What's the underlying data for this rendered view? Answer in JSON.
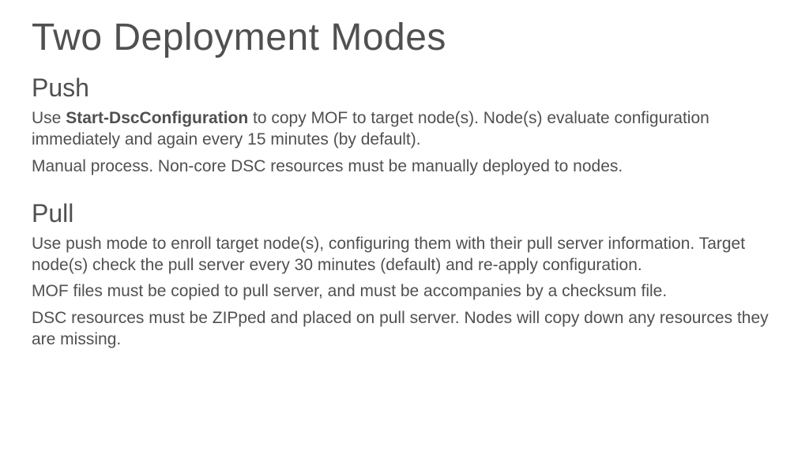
{
  "title": "Two Deployment Modes",
  "sections": [
    {
      "heading": "Push",
      "paragraphs": [
        {
          "prefix": "Use ",
          "bold": "Start-DscConfiguration",
          "suffix": " to copy MOF to target node(s). Node(s) evaluate configuration immediately and again every 15 minutes (by default)."
        },
        {
          "text": "Manual process. Non-core DSC resources must be manually deployed to nodes."
        }
      ]
    },
    {
      "heading": "Pull",
      "paragraphs": [
        {
          "text": "Use push mode to enroll target node(s), configuring them with their pull server information. Target node(s) check the pull server every 30 minutes (default) and re-apply configuration."
        },
        {
          "text": "MOF files must be copied to pull server, and must be accompanies by a checksum file."
        },
        {
          "text": "DSC resources must be ZIPped and placed on pull server. Nodes will copy down any resources they are missing."
        }
      ]
    }
  ]
}
